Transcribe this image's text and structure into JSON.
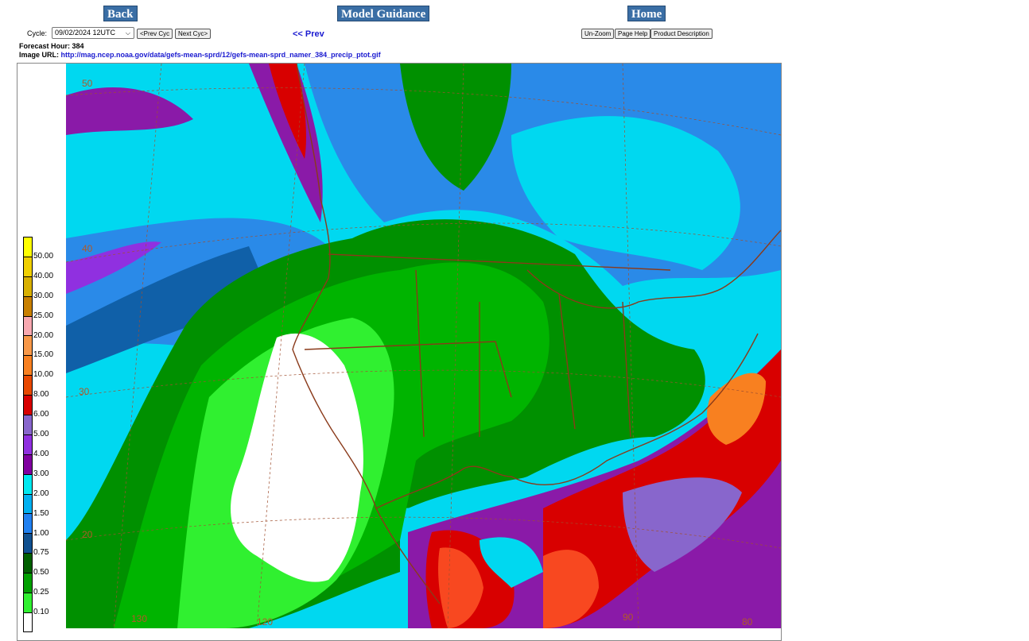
{
  "nav": {
    "back": "Back",
    "title": "Model Guidance",
    "home": "Home"
  },
  "controls": {
    "cycle_label": "Cycle:",
    "cycle_value": "09/02/2024 12UTC",
    "prev_cyc": "<Prev Cyc",
    "next_cyc": "Next Cyc>",
    "prev_link": "<< Prev",
    "unzoom": "Un-Zoom",
    "page_help": "Page Help",
    "product_description": "Product Description"
  },
  "info": {
    "forecast_hour_label": "Forecast Hour:",
    "forecast_hour": "384",
    "image_url_label": "Image URL:",
    "image_url": "http://mag.ncep.noaa.gov/data/gefs-mean-sprd/12/gefs-mean-sprd_namer_384_precip_ptot.gif"
  },
  "legend": {
    "labels": [
      "50.00",
      "40.00",
      "30.00",
      "25.00",
      "20.00",
      "15.00",
      "10.00",
      "8.00",
      "6.00",
      "5.00",
      "4.00",
      "3.00",
      "2.00",
      "1.50",
      "1.00",
      "0.75",
      "0.50",
      "0.25",
      "0.10"
    ],
    "colors": [
      "#ffff00",
      "#f0d000",
      "#d8b000",
      "#c88000",
      "#f8a8b0",
      "#f89848",
      "#f88020",
      "#e84800",
      "#d80000",
      "#8866cc",
      "#9030e0",
      "#8000a0",
      "#00e8f0",
      "#00b0f0",
      "#2080f0",
      "#105090",
      "#006000",
      "#00a000",
      "#30f030",
      "#ffffff"
    ]
  },
  "map": {
    "lat_labels": [
      "50",
      "40",
      "30",
      "20"
    ],
    "lon_labels": [
      "130",
      "120",
      "90",
      "80"
    ]
  }
}
